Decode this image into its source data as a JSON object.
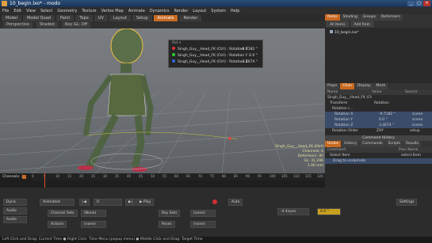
{
  "window": {
    "title": "10_begin.lxo* - modo",
    "buttons": [
      "_",
      "▢",
      "✕"
    ]
  },
  "menu": [
    "File",
    "Edit",
    "View",
    "Select",
    "Geometry",
    "Texture",
    "Vertex Map",
    "Animate",
    "Dynamics",
    "Render",
    "Layout",
    "System",
    "Help"
  ],
  "layout_tabs": [
    {
      "label": "Model",
      "active": false
    },
    {
      "label": "Model Quad",
      "active": false
    },
    {
      "label": "Paint",
      "active": false
    },
    {
      "label": "Topo",
      "active": false
    },
    {
      "label": "UV",
      "active": false
    },
    {
      "label": "Layout",
      "active": false
    },
    {
      "label": "Setup",
      "active": false
    },
    {
      "label": "Animate",
      "active": true
    },
    {
      "label": "Render",
      "active": false
    }
  ],
  "viewport_toolbar": [
    "Perspective",
    "Shaded",
    "Ray GL: Off"
  ],
  "channel_popup": {
    "title": "Rot x",
    "rows": [
      {
        "label": "Singh_Guy__Head_FK (Ctrl) : Rotation X",
        "value": "-9.7182 °",
        "color": "#d33"
      },
      {
        "label": "Singh_Guy__Head_FK (Ctrl) : Rotation Y",
        "value": "0.0 °",
        "color": "#3c3"
      },
      {
        "label": "Singh_Guy__Head_FK (Ctrl) : Rotation Z",
        "value": "3.4674 °",
        "color": "#36d"
      }
    ]
  },
  "viewport_info": [
    "Singh_Guy__Head_FK (Ctrl)",
    "Channels: 6",
    "Deformers: 4h",
    "GL: 31,296",
    "1.00 mm"
  ],
  "timeline": {
    "label": "Channels: 3",
    "ticks": [
      "0",
      "5",
      "10",
      "15",
      "20",
      "25",
      "30",
      "35",
      "40",
      "45",
      "50",
      "55",
      "60",
      "65",
      "70",
      "75",
      "80",
      "85",
      "90",
      "95",
      "100",
      "105",
      "110",
      "115",
      "120"
    ]
  },
  "right_panel": {
    "top_tabs": [
      {
        "label": "Items",
        "active": true
      },
      {
        "label": "Shading",
        "active": false
      },
      {
        "label": "Groups",
        "active": false
      },
      {
        "label": "Deformers",
        "active": false
      }
    ],
    "items_toolbar": {
      "filter": "All Items",
      "button": "Add Item"
    },
    "scene_item": "10_begin.lxo*",
    "prop_tabs": [
      {
        "label": "Props",
        "active": false
      },
      {
        "label": "Chan",
        "active": true
      },
      {
        "label": "Display",
        "active": false
      },
      {
        "label": "Mesh",
        "active": false
      }
    ],
    "channels_header": [
      "Name",
      "Value",
      "Source"
    ],
    "channels": [
      {
        "name": "Singh_Guy__Head_FK (Ctrl)",
        "value": "",
        "source": ""
      },
      {
        "name": "Transform",
        "value": "Rotation",
        "source": ""
      },
      {
        "name": "Rotation (...",
        "value": "",
        "source": ""
      },
      {
        "name": "Rotation X",
        "value": "-9.7182 °",
        "source": "scene"
      },
      {
        "name": "Rotation Y",
        "value": "0.0 °",
        "source": "scene"
      },
      {
        "name": "Rotation Z",
        "value": "3.4674 °",
        "source": "scene"
      },
      {
        "name": "Rotation Order",
        "value": "ZXY",
        "source": "setup"
      }
    ],
    "command_history": {
      "title": "Command History",
      "tabs": [
        {
          "label": "Undos",
          "active": true
        },
        {
          "label": "History",
          "active": false
        },
        {
          "label": "Commands",
          "active": false
        },
        {
          "label": "Scripts",
          "active": false
        },
        {
          "label": "Results",
          "active": false
        }
      ],
      "header": [
        "Command",
        "Prev Name"
      ],
      "rows": [
        {
          "cmd": "Select Item",
          "prev": "select.Item"
        },
        {
          "cmd": "Drag to undo/redo",
          "prev": ""
        }
      ]
    }
  },
  "bottom_controls": {
    "left_buttons": [
      "Dyna",
      "Audio",
      "Audio"
    ],
    "animated_dropdown": "Animated",
    "frame_value": "0",
    "play_label": "Play",
    "channel_sets": "Channel Sets",
    "channel_sets_value": "(None)",
    "actions": "Actions",
    "actions_value": "(none)",
    "key_sets": "Key Sets",
    "key_sets_value": "(none)",
    "poses": "Poses",
    "poses_value": "(none)",
    "field_auto": "Auto",
    "rot_value": "0.0 °",
    "angle_value": "-4 4eyes",
    "settings": "Settings"
  },
  "status_bar": "Left Click and Drag: Current Time  ●  Right Click: Time Menu (popup menu)  ●  Middle Click and Drag: Target Time"
}
